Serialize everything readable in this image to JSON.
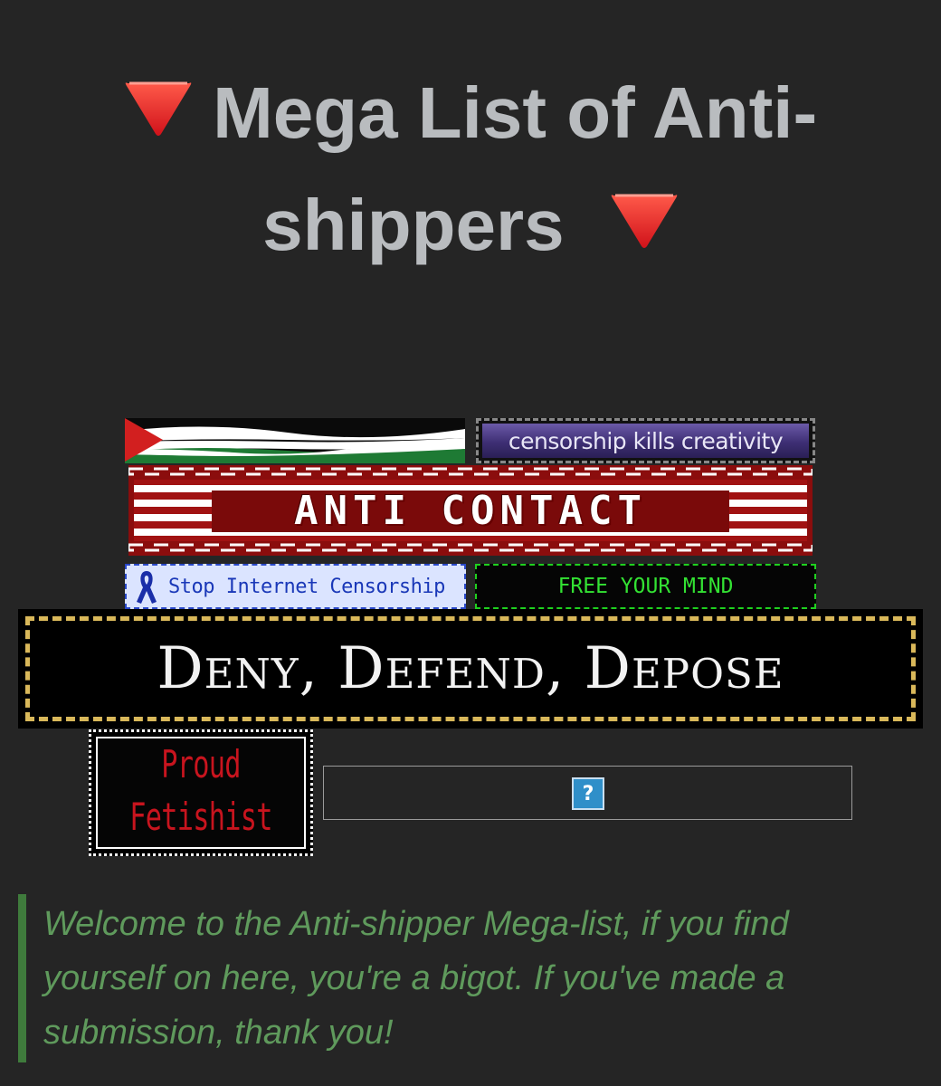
{
  "title": {
    "text": "Mega List of Anti-shippers",
    "line1": "Mega List of Anti-",
    "line2": "shippers",
    "emoji": "red-triangle-down-icon",
    "color": "#b9bcbf"
  },
  "buttons": {
    "censorship": "censorship kills creativity",
    "anti_contact": "ANTI CONTACT",
    "stop_censorship": "Stop Internet Censorship",
    "free_mind": "FREE YOUR MIND",
    "deny_defend": "Deny, Defend, Depose",
    "proud_line1": "Proud",
    "proud_line2": "Fetishist",
    "broken_image": "?"
  },
  "quote": {
    "text": "Welcome to the Anti-shipper Mega-list, if you find yourself on here, you're a bigot. If you've made a submission, thank you!",
    "bar_color": "#3f7b3c",
    "text_color": "#5f9a5c"
  },
  "colors": {
    "background": "#252525",
    "palestine_red": "#d21f1f",
    "palestine_green": "#1e7a34"
  }
}
